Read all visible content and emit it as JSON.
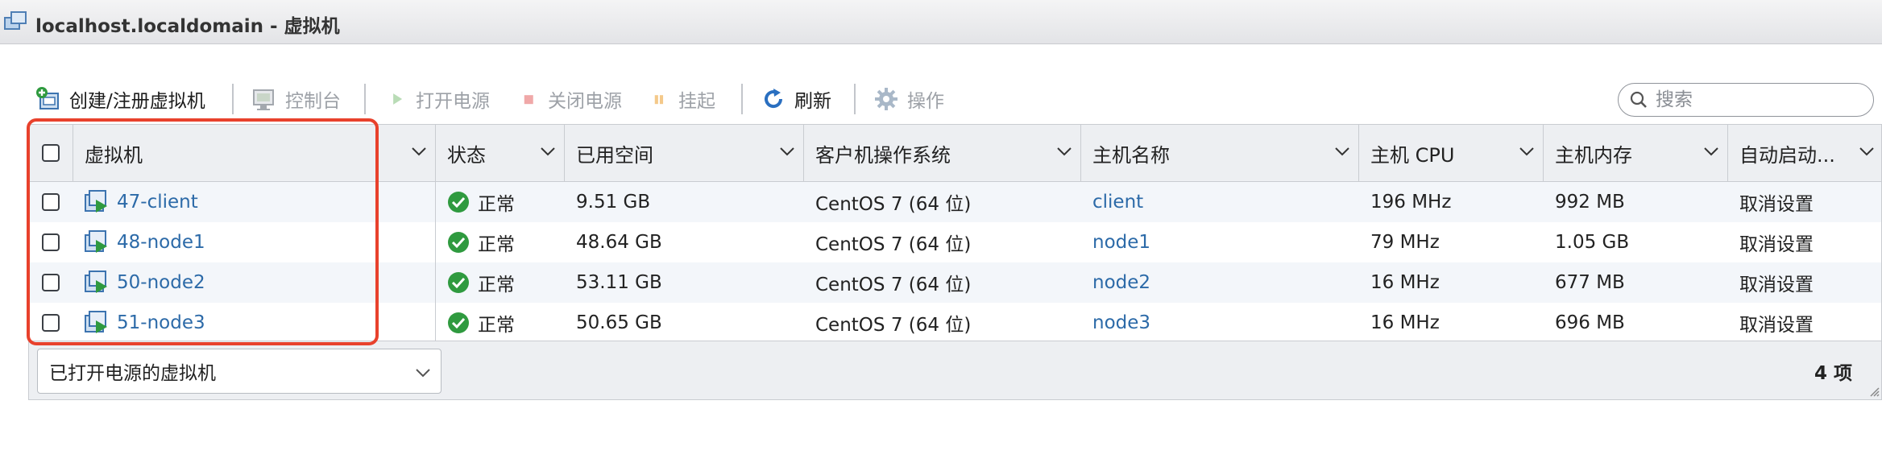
{
  "window": {
    "title": "localhost.localdomain - 虚拟机",
    "icon": "vm-group-icon"
  },
  "toolbar": {
    "create": {
      "label": "创建/注册虚拟机",
      "icon": "create-vm-icon",
      "enabled": true
    },
    "console": {
      "label": "控制台",
      "icon": "console-icon",
      "enabled": false
    },
    "power_on": {
      "label": "打开电源",
      "icon": "play-icon",
      "enabled": false
    },
    "power_off": {
      "label": "关闭电源",
      "icon": "stop-icon",
      "enabled": false
    },
    "suspend": {
      "label": "挂起",
      "icon": "pause-icon",
      "enabled": false
    },
    "refresh": {
      "label": "刷新",
      "icon": "refresh-icon",
      "enabled": true
    },
    "actions": {
      "label": "操作",
      "icon": "gear-icon",
      "enabled": false
    }
  },
  "search": {
    "placeholder": "搜索",
    "value": "",
    "icon": "search-icon"
  },
  "table": {
    "columns": [
      {
        "label": "虚拟机"
      },
      {
        "label": "状态"
      },
      {
        "label": "已用空间"
      },
      {
        "label": "客户机操作系统"
      },
      {
        "label": "主机名称"
      },
      {
        "label": "主机 CPU"
      },
      {
        "label": "主机内存"
      },
      {
        "label": "自动启动..."
      }
    ],
    "rows": [
      {
        "name": "47-client",
        "status": "正常",
        "used_space": "9.51 GB",
        "guest_os": "CentOS 7 (64 位)",
        "hostname": "client",
        "cpu": "196 MHz",
        "memory": "992 MB",
        "autostart": "取消设置"
      },
      {
        "name": "48-node1",
        "status": "正常",
        "used_space": "48.64 GB",
        "guest_os": "CentOS 7 (64 位)",
        "hostname": "node1",
        "cpu": "79 MHz",
        "memory": "1.05 GB",
        "autostart": "取消设置"
      },
      {
        "name": "50-node2",
        "status": "正常",
        "used_space": "53.11 GB",
        "guest_os": "CentOS 7 (64 位)",
        "hostname": "node2",
        "cpu": "16 MHz",
        "memory": "677 MB",
        "autostart": "取消设置"
      },
      {
        "name": "51-node3",
        "status": "正常",
        "used_space": "50.65 GB",
        "guest_os": "CentOS 7 (64 位)",
        "hostname": "node3",
        "cpu": "16 MHz",
        "memory": "696 MB",
        "autostart": "取消设置"
      }
    ]
  },
  "footer": {
    "filter_value": "已打开电源的虚拟机",
    "item_count": "4 项"
  },
  "colors": {
    "link": "#2c6aa8",
    "status_ok": "#2f9a3f",
    "highlight": "#e8412c",
    "header_bg": "#edeff2"
  }
}
